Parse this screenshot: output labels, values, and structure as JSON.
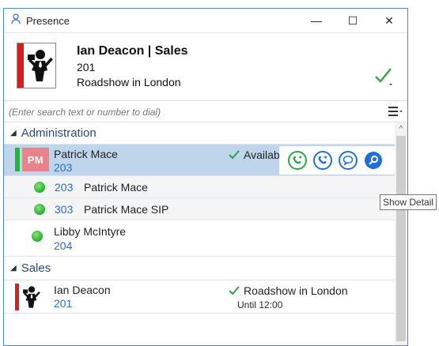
{
  "window": {
    "title": "Presence",
    "controls": {
      "minimize": "—",
      "maximize": "☐",
      "close": "✕"
    }
  },
  "header": {
    "name": "Ian Deacon | Sales",
    "extension": "201",
    "status": "Roadshow in London",
    "status_icon": "green-check-icon",
    "brand_color": "#d61f1f"
  },
  "search": {
    "placeholder": "(Enter search text or number to dial)",
    "menu_icon": "hamburger-menu-icon"
  },
  "sections": [
    {
      "label": "Administration",
      "contacts": [
        {
          "name": "Patrick Mace",
          "extension": "203",
          "initials": "PM",
          "status": "Availabl",
          "selected": true,
          "subentries": [
            {
              "extension": "203",
              "name": "Patrick Mace"
            },
            {
              "extension": "303",
              "name": "Patrick Mace SIP"
            }
          ]
        },
        {
          "name": "Libby McIntyre",
          "extension": "204"
        }
      ]
    },
    {
      "label": "Sales",
      "contacts": [
        {
          "name": "Ian Deacon",
          "extension": "201",
          "status": "Roadshow in London",
          "substatus": "Until 12:00"
        }
      ]
    }
  ],
  "tooltip": {
    "label": "Show Detail"
  },
  "colors": {
    "selection": "#bfd5ec",
    "accent": "#1e6fd9",
    "available": "#23b53d"
  }
}
